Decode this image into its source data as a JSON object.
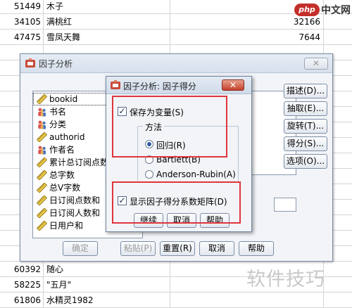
{
  "grid": {
    "rows": [
      {
        "id": "51449",
        "name": "木子",
        "num": ""
      },
      {
        "id": "34105",
        "name": "满桃红",
        "num": "32166"
      },
      {
        "id": "47475",
        "name": "雪凤天舞",
        "num": "7644"
      },
      {
        "id": "",
        "name": "",
        "num": ""
      },
      {
        "id": "",
        "name": "",
        "num": ""
      },
      {
        "id": "",
        "name": "",
        "num": ""
      },
      {
        "id": "",
        "name": "",
        "num": ""
      },
      {
        "id": "",
        "name": "",
        "num": ""
      },
      {
        "id": "",
        "name": "",
        "num": ""
      },
      {
        "id": "",
        "name": "",
        "num": ""
      },
      {
        "id": "",
        "name": "",
        "num": ""
      },
      {
        "id": "",
        "name": "",
        "num": ""
      },
      {
        "id": "",
        "name": "",
        "num": ""
      },
      {
        "id": "",
        "name": "",
        "num": ""
      },
      {
        "id": "",
        "name": "",
        "num": ""
      },
      {
        "id": "",
        "name": "",
        "num": ""
      },
      {
        "id": "",
        "name": "",
        "num": ""
      },
      {
        "id": "60392",
        "name": "随心",
        "num": ""
      },
      {
        "id": "58225",
        "name": "\"五月\"",
        "num": ""
      },
      {
        "id": "61806",
        "name": "水精灵1982",
        "num": ""
      }
    ]
  },
  "watermark": {
    "top_logo": "php",
    "top_text": "中文网",
    "bottom_text": "软件技巧"
  },
  "main_dialog": {
    "title": "因子分析",
    "close_label": "✕",
    "variables": [
      {
        "label": "bookid",
        "icon": "ruler-icon"
      },
      {
        "label": "书名",
        "icon": "nominal-people-icon"
      },
      {
        "label": "分类",
        "icon": "nominal-people-icon"
      },
      {
        "label": "authorid",
        "icon": "ruler-icon"
      },
      {
        "label": "作者名",
        "icon": "nominal-people-icon"
      },
      {
        "label": "累计总订阅点数",
        "icon": "ruler-icon"
      },
      {
        "label": "总字数",
        "icon": "ruler-icon"
      },
      {
        "label": "总V字数",
        "icon": "ruler-icon"
      },
      {
        "label": "日订阅点数和",
        "icon": "ruler-icon"
      },
      {
        "label": "日订阅人数和",
        "icon": "ruler-icon"
      },
      {
        "label": "日用户和",
        "icon": "ruler-icon"
      }
    ],
    "side_buttons": [
      "描述(D)...",
      "抽取(E)...",
      "旋转(T)...",
      "得分(S)...",
      "选项(O)..."
    ],
    "bottom_buttons": {
      "ok": "确定",
      "paste": "粘贴(P)",
      "reset": "重置(R)",
      "cancel": "取消",
      "help": "帮助"
    }
  },
  "sub_dialog": {
    "title": "因子分析: 因子得分",
    "close_label": "✕",
    "save_as_variables": {
      "label": "保存为变量(S)",
      "checked": true
    },
    "method_group_label": "方法",
    "methods": [
      {
        "label": "回归(R)",
        "selected": true
      },
      {
        "label": "Bartlett(B)",
        "selected": false
      },
      {
        "label": "Anderson-Rubin(A)",
        "selected": false
      }
    ],
    "display_matrix": {
      "label": "显示因子得分系数矩阵(D)",
      "checked": true
    },
    "buttons": {
      "continue": "继续",
      "cancel": "取消",
      "help": "帮助"
    }
  },
  "colors": {
    "highlight_box": "#e0353c",
    "dialog_bg": "#f2f4f8",
    "title_bar": "#d7e0ec"
  }
}
